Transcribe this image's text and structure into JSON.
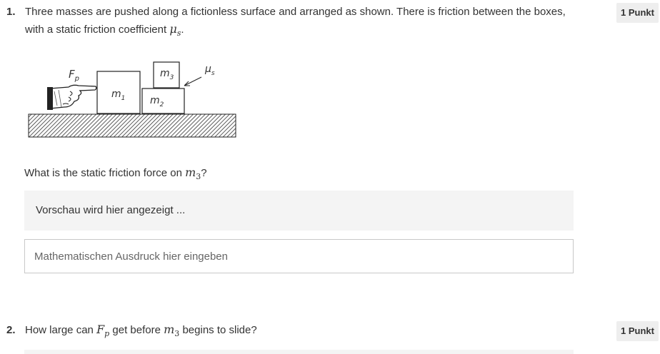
{
  "question1": {
    "number": "1.",
    "text": "Three masses are pushed along a fictionless surface and arranged as shown. There is friction between the boxes,",
    "text_cont": "with a static friction coefficient",
    "mu_symbol": "μ",
    "mu_sub": "s",
    "period": ".",
    "points": "1 Punkt",
    "diagram": {
      "force_label": "F",
      "force_sub": "p",
      "mass1_label": "m",
      "mass1_sub": "1",
      "mass2_label": "m",
      "mass2_sub": "2",
      "mass3_label": "m",
      "mass3_sub": "3",
      "mu_label": "μ",
      "mu_sub": "s"
    },
    "subquestion_prefix": "What is the static friction force on",
    "subquestion_var": "m",
    "subquestion_sub": "3",
    "subquestion_suffix": "?",
    "preview_text": "Vorschau wird hier angezeigt ...",
    "input_placeholder": "Mathematischen Ausdruck hier eingeben"
  },
  "question2": {
    "number": "2.",
    "text_prefix": "How large can",
    "var_f": "F",
    "var_f_sub": "p",
    "text_mid": "get before",
    "var_m": "m",
    "var_m_sub": "3",
    "text_suffix": "begins to slide?",
    "points": "1 Punkt"
  }
}
